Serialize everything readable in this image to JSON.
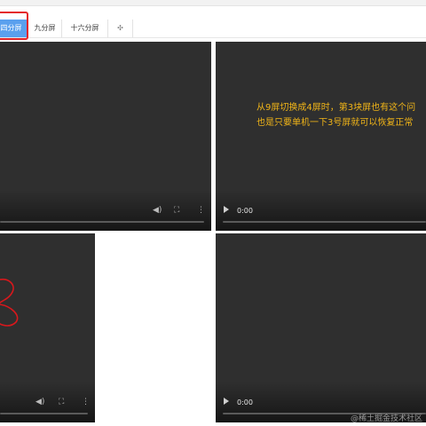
{
  "tabs": [
    {
      "label": "四分屏",
      "active": true
    },
    {
      "label": "九分屏",
      "active": false
    },
    {
      "label": "十六分屏",
      "active": false
    },
    {
      "label": "✣",
      "active": false
    }
  ],
  "panes": [
    {
      "time": ""
    },
    {
      "time": "0:00"
    },
    {
      "time": ""
    },
    {
      "time": "0:00"
    }
  ],
  "overlay": {
    "line1": "从9屏切换成4屏时，第3块屏也有这个问",
    "line2": "也是只要单机一下3号屏就可以恢复正常"
  },
  "watermark": "@稀土掘金技术社区",
  "colors": {
    "tab_active": "#5aa0ee",
    "highlight": "#e4262b",
    "annotation_text": "#f0b418",
    "scribble": "#d8181c"
  },
  "icons": {
    "volume": "volume-icon",
    "fullscreen": "fullscreen-icon",
    "menu": "more-vertical-icon",
    "play": "play-icon"
  }
}
